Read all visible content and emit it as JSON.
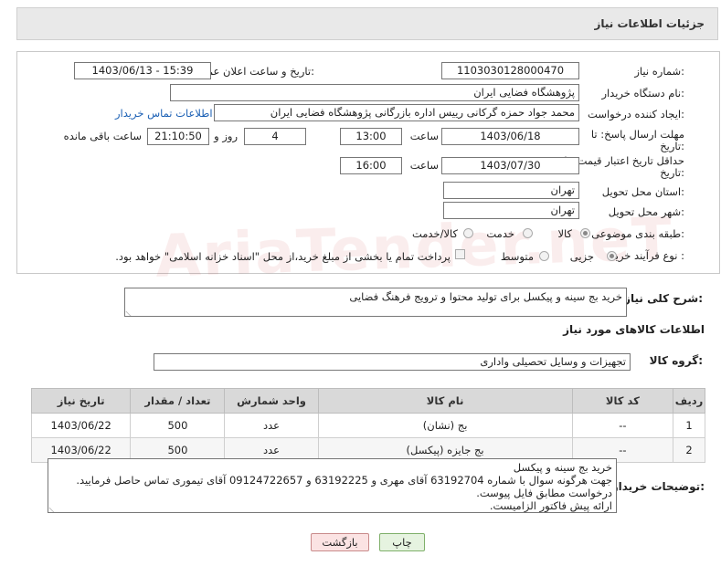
{
  "header": {
    "title": "جزئیات اطلاعات نیاز"
  },
  "form": {
    "need_number_label": "شماره نیاز:",
    "need_number": "1103030128000470",
    "announce_label": "تاریخ و ساعت اعلان عمومی:",
    "announce_value": "1403/06/13 - 15:39",
    "buyer_org_label": "نام دستگاه خریدار:",
    "buyer_org": "پژوهشگاه فضایی ایران",
    "creator_label": "ایجاد کننده درخواست:",
    "creator": "محمد جواد حمزه گرکانی رییس اداره بازرگانی پژوهشگاه فضایی ایران",
    "contact_link": "اطلاعات تماس خریدار",
    "deadline_label_1": "مهلت ارسال پاسخ: تا",
    "deadline_label_2": "تاریخ:",
    "deadline_date": "1403/06/18",
    "time_label": "ساعت",
    "deadline_time": "13:00",
    "days_value": "4",
    "days_label": "روز و",
    "remaining_value": "21:10:50",
    "remaining_label": "ساعت باقی مانده",
    "validity_label_1": "حداقل تاریخ اعتبار قیمت: تا",
    "validity_label_2": "تاریخ:",
    "validity_date": "1403/07/30",
    "validity_time_label": "ساعت",
    "validity_time": "16:00",
    "province_label": "استان محل تحویل:",
    "province": "تهران",
    "city_label": "شهر محل تحویل:",
    "city": "تهران",
    "category_label": "طبقه بندی موضوعی:",
    "category_options": [
      "کالا",
      "خدمت",
      "کالا/خدمت"
    ],
    "category_selected": "کالا",
    "process_label": "نوع فرآیند خرید :",
    "process_options": [
      "جزیی",
      "متوسط"
    ],
    "process_selected": "جزیی",
    "payment_note": "پرداخت تمام یا بخشی از مبلغ خرید،از محل \"اسناد خزانه اسلامی\" خواهد بود."
  },
  "summary": {
    "label": "شرح کلی نیاز:",
    "value": "خرید بج سینه و پیکسل برای تولید محتوا و ترویج فرهنگ فضایی"
  },
  "goods_info": {
    "section_title": "اطلاعات کالاهای مورد نیاز",
    "group_label": "گروه کالا:",
    "group_value": "تجهیزات و وسایل تحصیلی واداری"
  },
  "table": {
    "headers": [
      "ردیف",
      "کد کالا",
      "نام کالا",
      "واحد شمارش",
      "تعداد / مقدار",
      "تاریخ نیاز"
    ],
    "rows": [
      {
        "idx": "1",
        "code": "--",
        "name": "بج (نشان)",
        "unit": "عدد",
        "qty": "500",
        "date": "1403/06/22"
      },
      {
        "idx": "2",
        "code": "--",
        "name": "بج جایزه (پیکسل)",
        "unit": "عدد",
        "qty": "500",
        "date": "1403/06/22"
      }
    ]
  },
  "buyer_notes": {
    "label": "توضیحات خریدار:",
    "lines": [
      "خرید بج سینه و پیکسل",
      "جهت هرگونه سوال با شماره 63192704 آقای مهری و 63192225 و 09124722657 آقای تیموری تماس حاصل فرمایید.",
      "درخواست مطابق فایل پیوست.",
      "ارائه پیش فاکتور الزامیست."
    ]
  },
  "buttons": {
    "print": "چاپ",
    "back": "بازگشت"
  },
  "watermark": "AriaTender.neT",
  "colors": {
    "link": "#1a5fb4",
    "print_btn_bg": "#e6f3e0",
    "back_btn_bg": "#fbe3e3",
    "header_bg": "#e9e9e9"
  }
}
